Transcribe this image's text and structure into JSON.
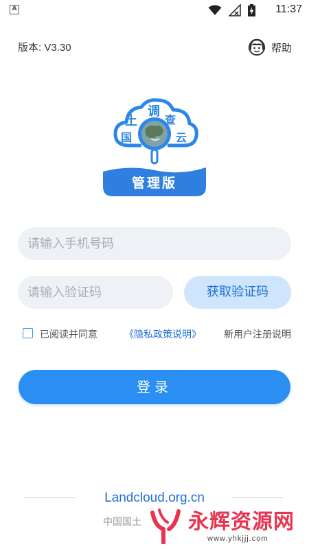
{
  "status_bar": {
    "time": "11:37",
    "icons": [
      "wifi-icon",
      "signal-off-icon",
      "battery-charging-icon"
    ]
  },
  "header": {
    "version": "版本: V3.30",
    "help_label": "帮助",
    "help_icon": "customer-service-icon"
  },
  "logo": {
    "chars": [
      "土",
      "调",
      "国",
      "查",
      "云"
    ],
    "badge": "管理版",
    "colors": {
      "primary": "#2e86e6",
      "badge": "#2e7fe0"
    }
  },
  "form": {
    "phone_placeholder": "请输入手机号码",
    "code_placeholder": "请输入验证码",
    "get_code_label": "获取验证码",
    "agree_text": "已阅读并同意",
    "privacy_link": "《隐私政策说明》",
    "new_user_link": "新用户注册说明",
    "login_label": "登录"
  },
  "footer": {
    "site": "Landcloud.org.cn",
    "org_partial": "中国国土"
  },
  "watermark": {
    "text": "永辉资源网",
    "url": "www.yhkjjj.com"
  },
  "colors": {
    "accent": "#2b8ef3",
    "link": "#1d6fd6",
    "input_bg": "#eef1f5",
    "get_code_bg": "#cfe5fb",
    "watermark": "#e8344e"
  }
}
